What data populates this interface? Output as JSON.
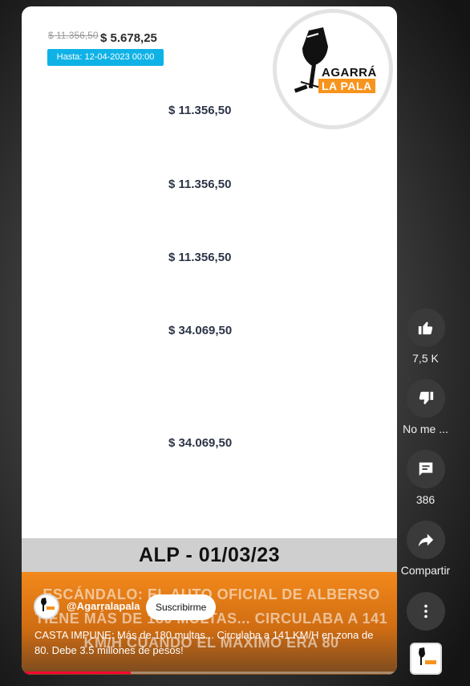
{
  "content": {
    "old_price": "$ 11.356,50",
    "new_price": "$ 5.678,25",
    "until_badge": "Hasta: 12-04-2023 00:00",
    "price_rows": [
      "$ 11.356,50",
      "$ 11.356,50",
      "$ 11.356,50",
      "$ 34.069,50",
      "$ 34.069,50"
    ]
  },
  "logo": {
    "line1": "AGARRÁ",
    "line2": "LA PALA"
  },
  "overlay": {
    "date_label": "ALP - 01/03/23",
    "headline": "ESCÁNDALO: EL AUTO OFICIAL DE ALBERSO TIENE MÁS DE 180 MULTAS... CIRCULABA A 141 KM/H CUANDO EL MÁXIMO ERA 80",
    "channel_handle": "@Agarralapala",
    "subscribe_label": "Suscribirme",
    "description": "CASTA IMPUNE: Más de 180 multas... Circulaba a 141 KM/H en zona de 80. Debe 3.5 millones de pesos!",
    "progress_fraction": 0.29
  },
  "actions": {
    "like_count": "7,5 K",
    "dislike_label": "No me ...",
    "comment_count": "386",
    "share_label": "Compartir"
  },
  "colors": {
    "accent_orange": "#f3891c",
    "badge_blue": "#0fb2e6",
    "progress_red": "#ff0033"
  }
}
